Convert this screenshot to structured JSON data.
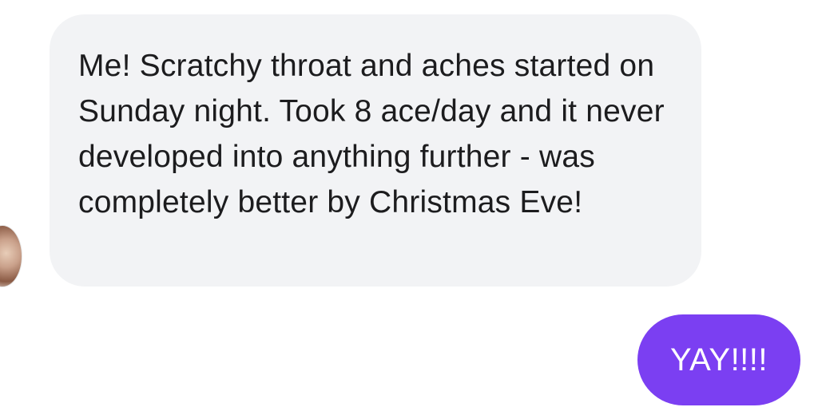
{
  "conversation": {
    "incoming": {
      "text": "Me! Scratchy throat and aches started on Sunday night. Took 8 ace/day and it never developed into anything further - was completely better by Christmas Eve!",
      "avatar": "contact-avatar-photo"
    },
    "outgoing": {
      "text": "YAY!!!!"
    }
  },
  "colors": {
    "incoming_bubble": "#f2f3f5",
    "outgoing_bubble": "#7b3ff2",
    "incoming_text": "#1c1c1e",
    "outgoing_text": "#ffffff"
  }
}
